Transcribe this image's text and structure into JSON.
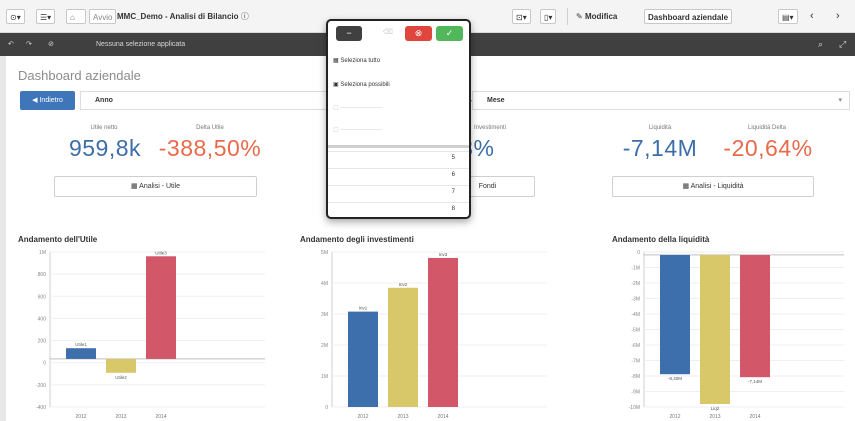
{
  "toolbar": {
    "nav_label": "Avvio",
    "app_name": "MMC_Demo - Analisi di Bilancio",
    "edit_label": "Modifica",
    "sheet_name": "Dashboard aziendale"
  },
  "selections": {
    "label": "Nessuna selezione applicata"
  },
  "sheet": {
    "title": "Dashboard aziendale",
    "back_label": "Indietro",
    "filter_year": "Anno",
    "filter_month": "Mese"
  },
  "kpis": [
    {
      "label": "Utile netto",
      "value": "959,8k",
      "color": "#3d6ea9"
    },
    {
      "label": "Delta Utile",
      "value": "-388,50%",
      "color": "#e86a4a"
    },
    {
      "label": "Investimenti",
      "value": ",23%",
      "color": "#3d6ea9"
    },
    {
      "label": "Liquidità",
      "value": "-7,14M",
      "color": "#3d6ea9"
    },
    {
      "label": "Liquidità Delta",
      "value": "-20,64%",
      "color": "#e86a4a"
    }
  ],
  "analysis_buttons": {
    "utile": "Analisi - Utile",
    "fondi": "Fondi",
    "liquidita": "Analisi - Liquidità"
  },
  "popup": {
    "cancel_icon": "minus-icon",
    "clear_icon": "clear-icon",
    "confirm_icon": "check-icon",
    "select_all": "Seleziona tutto",
    "select_possible": "Seleziona possibili",
    "rows": [
      "5",
      "6",
      "7",
      "8"
    ]
  },
  "chart_data": [
    {
      "type": "bar",
      "title": "Andamento dell'Utile",
      "categories": [
        "2012",
        "2013",
        "2014"
      ],
      "values": [
        0.1,
        -0.13,
        0.96
      ],
      "data_labels": [
        "Utile1",
        "Utile2",
        "Utile3"
      ],
      "colors": [
        "#3e6fad",
        "#d8c86a",
        "#d25869"
      ],
      "y_ticks": [
        "1M",
        "800",
        "600",
        "400",
        "200",
        "0",
        "-200",
        "-400"
      ],
      "ylim": [
        -0.45,
        1.0
      ]
    },
    {
      "type": "bar",
      "title": "Andamento degli investimenti",
      "categories": [
        "2012",
        "2013",
        "2014"
      ],
      "values": [
        3.2,
        4.0,
        5.0
      ],
      "data_labels": [
        "Inv1",
        "Inv2",
        "Inv3"
      ],
      "colors": [
        "#3e6fad",
        "#d8c86a",
        "#d25869"
      ],
      "y_ticks": [
        "5M",
        "4M",
        "3M",
        "2M",
        "1M",
        "0"
      ],
      "ylim": [
        0,
        5.2
      ]
    },
    {
      "type": "bar",
      "title": "Andamento della liquidità",
      "categories": [
        "2012",
        "2013",
        "2014"
      ],
      "values": [
        -8.0,
        -10.0,
        -8.2
      ],
      "data_labels": [
        "-8,40M",
        "Liq2",
        "-7,14M"
      ],
      "colors": [
        "#3e6fad",
        "#d8c86a",
        "#d25869"
      ],
      "y_ticks": [
        "0",
        "-1M",
        "-2M",
        "-3M",
        "-4M",
        "-5M",
        "-6M",
        "-7M",
        "-8M",
        "-9M",
        "-10M"
      ],
      "ylim": [
        -10.2,
        0.2
      ]
    }
  ]
}
